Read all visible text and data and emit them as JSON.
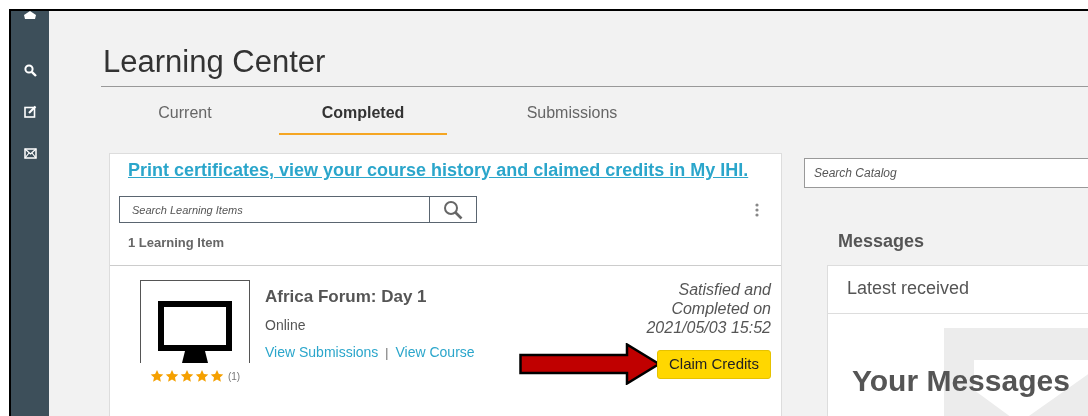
{
  "page_title": "Learning Center",
  "tabs": [
    {
      "label": "Current",
      "selected": false
    },
    {
      "label": "Completed",
      "selected": true
    },
    {
      "label": "Submissions",
      "selected": false
    }
  ],
  "learning_panel": {
    "banner_link": "Print certificates, view your course history and claimed credits in My IHI.",
    "search": {
      "placeholder": "Search Learning Items"
    },
    "count": "1 Learning Item",
    "items": [
      {
        "title": "Africa Forum: Day 1",
        "format": "Online",
        "links": [
          "View Submissions",
          "View Course"
        ],
        "link_separator": "|",
        "stars": 5,
        "rating_count": "(1)",
        "status": "Satisfied and Completed on 2021/05/03 15:52",
        "action": "Claim Credits"
      }
    ]
  },
  "catalog_search": {
    "placeholder": "Search Catalog"
  },
  "messages": {
    "heading": "Messages",
    "tab": "Latest received",
    "empty_title": "Your Messages"
  }
}
